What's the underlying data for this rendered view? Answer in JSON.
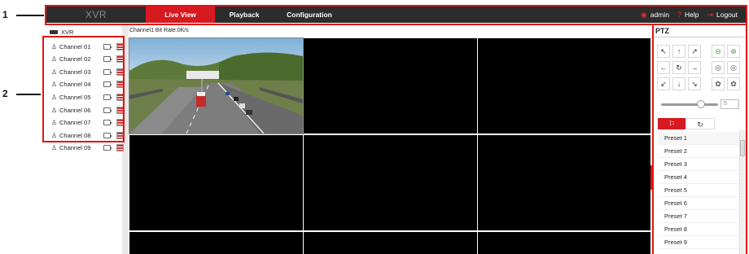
{
  "callouts": {
    "one": "1",
    "two": "2"
  },
  "topbar": {
    "logo": "XVR",
    "tabs": [
      {
        "label": "Live View",
        "active": true
      },
      {
        "label": "Playback",
        "active": false
      },
      {
        "label": "Configuration",
        "active": false
      }
    ],
    "user": "admin",
    "help": "Help",
    "logout": "Logout"
  },
  "tree": {
    "root": "XVR",
    "channels": [
      "Channel 01",
      "Channel 02",
      "Channel 03",
      "Channel 04",
      "Channel 05",
      "Channel 06",
      "Channel 07",
      "Channel 08",
      "Channel 09"
    ]
  },
  "video": {
    "status_line": "Channel1  Bit Rate:0K/s"
  },
  "ptz": {
    "title": "PTZ",
    "direction_buttons": [
      "↖",
      "↑",
      "↗",
      "←",
      "↻",
      "→",
      "↙",
      "↓",
      "↘"
    ],
    "zoom_buttons": [
      "zoom-out-icon",
      "zoom-in-icon",
      "focus-near-icon",
      "focus-far-icon",
      "iris-close-icon",
      "iris-open-icon"
    ],
    "speed": "5",
    "speed_level_fraction": 0.7,
    "tabs": [
      "⚐",
      "↻"
    ],
    "presets": [
      "Preset 1",
      "Preset 2",
      "Preset 3",
      "Preset 4",
      "Preset 5",
      "Preset 6",
      "Preset 7",
      "Preset 8",
      "Preset 9"
    ]
  },
  "colors": {
    "accent": "#d71920",
    "topbar": "#2c2c2c",
    "callout_box": "#e01515"
  }
}
